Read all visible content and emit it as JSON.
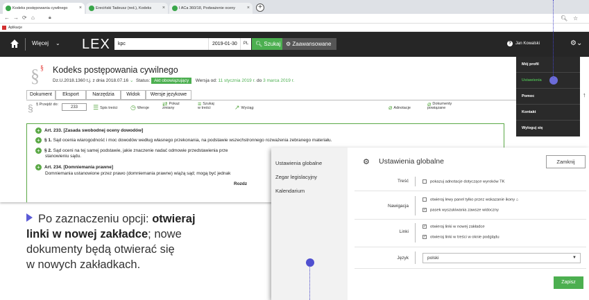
{
  "browser": {
    "tabs": [
      {
        "label": "Kodeks postępowania cywilnego"
      },
      {
        "label": "Ereciński Tadeusz (red.), Kodeks"
      },
      {
        "label": "I ACa 360/18, Podważenie oceny"
      }
    ],
    "new_tab": "+",
    "bookmarks_label": "Aplikacje",
    "url_icon": "lock-icon"
  },
  "lexbar": {
    "more_label": "Więcej",
    "logo": "LEX",
    "search_value": "kpc",
    "date_value": "2019-01-30",
    "lang": "PL",
    "search_button": "Szukaj",
    "advanced_button": "Zaawansowane",
    "user_name": "Jan Kowalski",
    "help": "?"
  },
  "user_menu": {
    "items": [
      "Mój profil",
      "Ustawienia",
      "Pomoc",
      "Kontakt",
      "Wyloguj się"
    ]
  },
  "document": {
    "title": "Kodeks postępowania cywilnego",
    "meta_ref": "Dz.U.2018.1360 t.j. z dnia 2018.07.16",
    "status_label": "Status:",
    "status_value": "Akt obowiązujący",
    "version_label": "Wersja od:",
    "version_from": "11 stycznia 2019 r.",
    "version_to_label": "do",
    "version_to": "3 marca 2019 r.",
    "tabs": [
      "Dokument",
      "Eksport",
      "Narzędzia",
      "Widok",
      "Wersje językowe"
    ],
    "tools": {
      "przejdz": "§ Przejdź do:",
      "przejdz_value": "233",
      "spis": "Spis treści",
      "wersje": "Wersje",
      "pokaz_1": "Pokaż",
      "pokaz_2": "zmiany",
      "szukaj_1": "Szukaj",
      "szukaj_2": "w treści",
      "wyciag": "Wyciąg",
      "adnotacje": "Adnotacje",
      "dokumenty_1": "Dokumenty",
      "dokumenty_2": "powiązane"
    },
    "articles": [
      {
        "num": "Art. 233.",
        "title": "[Zasada swobodnej oceny dowodów]"
      },
      {
        "num": "§ 1.",
        "text": "Sąd ocenia wiarogodność i moc dowodów według własnego przekonania, na podstawie wszechstronnego rozważenia zebranego materiału."
      },
      {
        "num": "§ 2.",
        "text": "Sąd oceni na tej samej podstawie, jakie znaczenie nadać odmowie przedstawienia prze",
        "text_2": "stanowieniu sądu."
      },
      {
        "num": "Art. 234.",
        "title": "[Domniemania prawne]"
      },
      {
        "text": "Domniemania ustanowione przez prawo (domniemania prawne) wiążą sąd; mogą być jednak"
      },
      {
        "text": "Rozdz"
      }
    ]
  },
  "settings": {
    "nav": [
      "Ustawienia globalne",
      "Zegar legislacyjny",
      "Kalendarium"
    ],
    "title": "Ustawienia globalne",
    "close_button": "Zamknij",
    "sections": {
      "tresc_label": "Treść",
      "tresc_opt": "pokazuj adnotacje dotyczące wyroków TK",
      "nawigacja_label": "Nawigacja",
      "nawigacja_opt1": "otwieraj lewy panel tylko przez wskazanie ikony",
      "nawigacja_opt2": "pasek wyszukiwania zawsze widoczny",
      "linki_label": "Linki",
      "linki_opt1": "otwieraj linki w nowej zakładce",
      "linki_opt2": "otwieraj linki w treści w oknie podglądu",
      "jezyk_label": "Język",
      "jezyk_value": "polski"
    },
    "save_button": "Zapisz"
  },
  "callout": {
    "line1": "Po zaznaczeniu opcji:",
    "bold1": "otwieraj",
    "bold2": "linki w nowej zakładce",
    "rest1": "; nowe",
    "line3": "dokumenty będą otwierać się",
    "line4": "w nowych zakładkach."
  },
  "colors": {
    "accent_green": "#4caf50",
    "dark_bar": "#262626",
    "pointer_blue": "#5050d0"
  }
}
